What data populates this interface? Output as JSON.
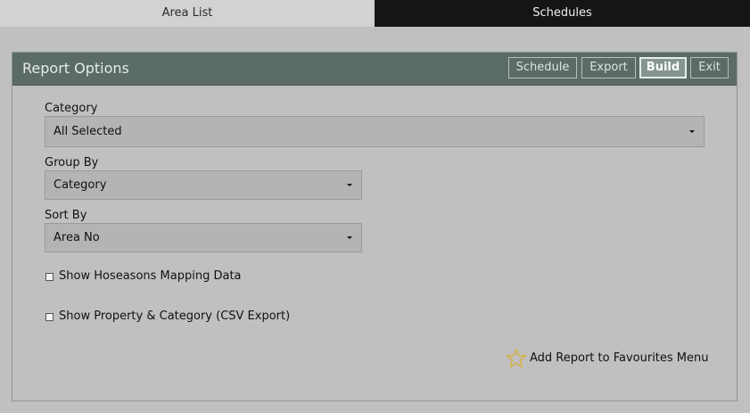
{
  "tabs": [
    {
      "label": "Area List"
    },
    {
      "label": "Schedules"
    }
  ],
  "panel": {
    "title": "Report Options",
    "buttons": {
      "schedule": "Schedule",
      "export": "Export",
      "build": "Build",
      "exit": "Exit"
    }
  },
  "form": {
    "category": {
      "label": "Category",
      "value": "All Selected"
    },
    "group_by": {
      "label": "Group By",
      "value": "Category"
    },
    "sort_by": {
      "label": "Sort By",
      "value": "Area No"
    },
    "show_mapping": {
      "label": "Show Hoseasons Mapping Data",
      "checked": false
    },
    "show_property": {
      "label": "Show Property & Category (CSV Export)",
      "checked": false
    }
  },
  "favourites": {
    "label": "Add Report to Favourites Menu",
    "icon": "star-outline-icon",
    "icon_color": "#d9b02a"
  },
  "colors": {
    "background": "#c0c0c0",
    "panel_header": "#5b6b67",
    "active_tab": "#151515",
    "active_button": "#859691"
  }
}
